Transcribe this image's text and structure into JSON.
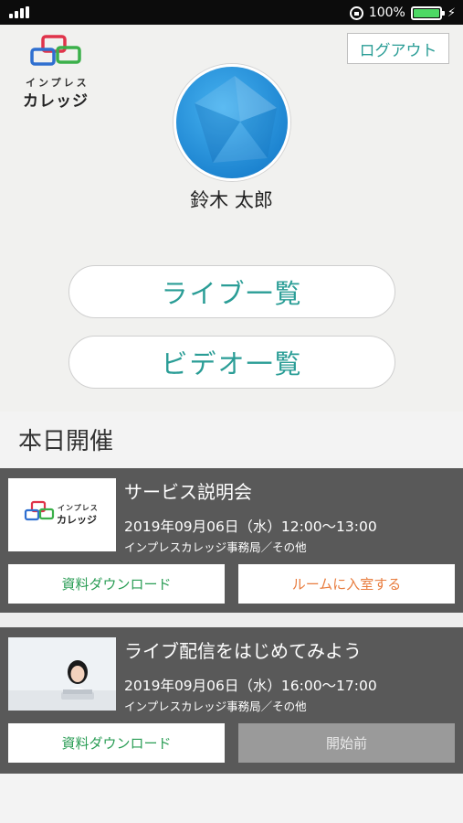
{
  "status_bar": {
    "battery_text": "100%",
    "battery_level": 1.0,
    "signal_icon": "signal-bars-icon",
    "lock_icon": "rotation-lock-icon",
    "charging_icon": "charging-bolt-icon",
    "battery_color": "#4cd964"
  },
  "header": {
    "logo_small": "インプレス",
    "logo_big": "カレッジ",
    "logout_label": "ログアウト"
  },
  "profile": {
    "name": "鈴木 太郎"
  },
  "nav": {
    "live_list_label": "ライブ一覧",
    "video_list_label": "ビデオ一覧"
  },
  "today": {
    "heading": "本日開催",
    "events": [
      {
        "title": "サービス説明会",
        "datetime": "2019年09月06日（水）12:00〜13:00",
        "organizer": "インプレスカレッジ事務局／その他",
        "thumb_logo_small": "インプレス",
        "thumb_logo_big": "カレッジ",
        "download_label": "資料ダウンロード",
        "action_label": "ルームに入室する"
      },
      {
        "title": "ライブ配信をはじめてみよう",
        "datetime": "2019年09月06日（水）16:00〜17:00",
        "organizer": "インプレスカレッジ事務局／その他",
        "download_label": "資料ダウンロード",
        "action_label": "開始前"
      }
    ]
  },
  "colors": {
    "accent": "#2a9d96",
    "download_text": "#2a9d55",
    "enter_text": "#e87c3e",
    "card_bg": "#595959",
    "disabled_bg": "#9a9a9a"
  }
}
